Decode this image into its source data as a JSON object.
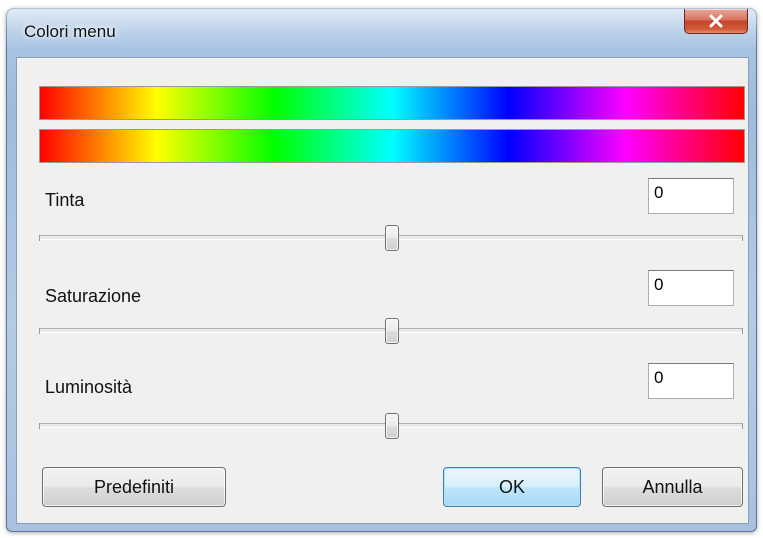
{
  "window": {
    "title": "Colori menu",
    "close_glyph": "x"
  },
  "sliders": [
    {
      "label": "Tinta",
      "value": "0",
      "position": 0.5
    },
    {
      "label": "Saturazione",
      "value": "0",
      "position": 0.5
    },
    {
      "label": "Luminosità",
      "value": "0",
      "position": 0.5
    }
  ],
  "buttons": {
    "defaults_label": "Predefiniti",
    "ok_label": "OK",
    "cancel_label": "Annulla"
  },
  "colors": {
    "titlebar": "#a8c3e2",
    "close_button": "#c6452b",
    "client_background": "#f0f0f0",
    "default_button": "#bee6fd"
  },
  "icons": {
    "close": "close-icon"
  }
}
